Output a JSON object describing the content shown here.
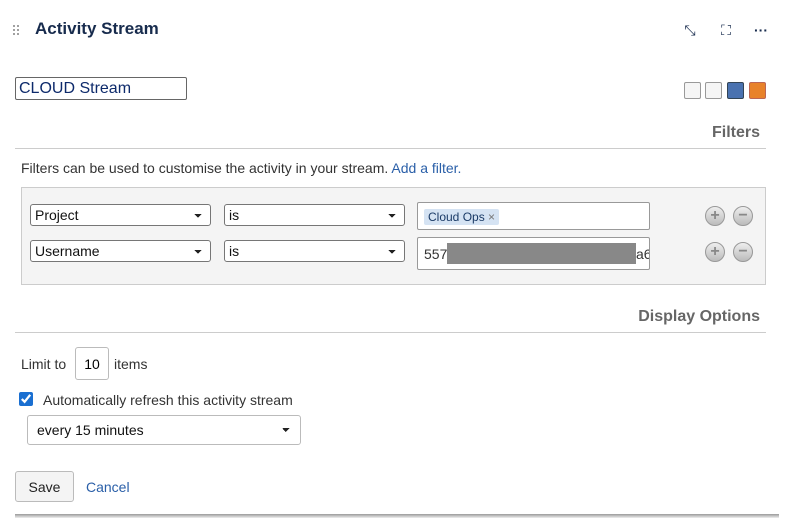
{
  "header": {
    "title": "Activity Stream",
    "collapse_icon": "minimize-icon",
    "expand_icon": "fullscreen-icon",
    "more_icon": "more-icon"
  },
  "stream_name": "CLOUD Stream",
  "toolbar_icons": [
    "full-view-icon",
    "list-view-icon",
    "filter-icon",
    "rss-icon"
  ],
  "filters": {
    "heading": "Filters",
    "help_text": "Filters can be used to customise the activity in your stream.",
    "add_link": "Add a filter.",
    "rows": [
      {
        "field": "Project",
        "operator": "is",
        "chip": "Cloud Ops",
        "chip_remove": "×"
      },
      {
        "field": "Username",
        "operator": "is",
        "value_prefix": "557",
        "value_suffix": "a6"
      }
    ]
  },
  "display": {
    "heading": "Display Options",
    "limit_label": "Limit to",
    "limit_value": "10",
    "items_label": "items",
    "auto_refresh_label": "Automatically refresh this activity stream",
    "auto_refresh_checked": true,
    "refresh_interval": "every 15 minutes"
  },
  "actions": {
    "save": "Save",
    "cancel": "Cancel"
  }
}
